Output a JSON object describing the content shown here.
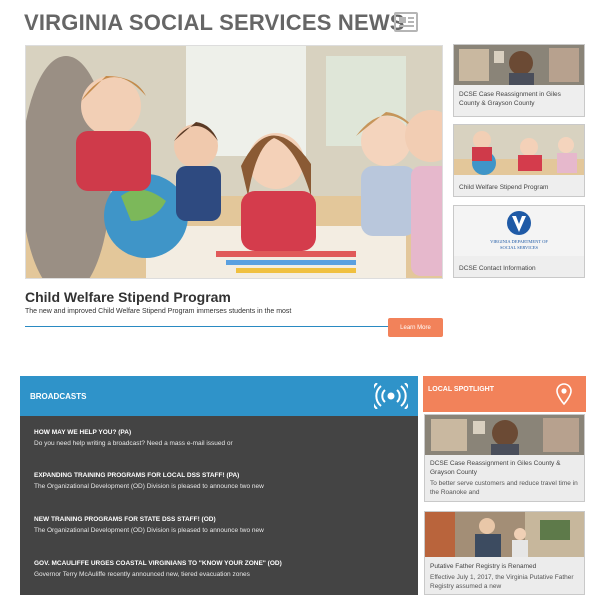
{
  "header": {
    "title": "VIRGINIA SOCIAL SERVICES NEWS",
    "icon": "newspaper-icon"
  },
  "featured": {
    "title": "Child Welfare Stipend Program",
    "description": "The new and improved Child Welfare Stipend Program immerses students in the most",
    "button_label": "Learn More"
  },
  "side_news": [
    {
      "label": "DCSE Case Reassignment in Giles County & Grayson County"
    },
    {
      "label": "Child Welfare Stipend Program"
    },
    {
      "label": "DCSE Contact Information",
      "logo_line1": "VIRGINIA DEPARTMENT OF",
      "logo_line2": "SOCIAL SERVICES"
    }
  ],
  "broadcasts": {
    "title": "BROADCASTS",
    "icon": "broadcast-icon",
    "items": [
      {
        "title": "HOW MAY WE HELP YOU? (PA)",
        "summary": "Do you need help writing a broadcast? Need a mass e-mail issued or"
      },
      {
        "title": "EXPANDING TRAINING PROGRAMS FOR LOCAL DSS STAFF! (PA)",
        "summary": "The Organizational Development (OD) Division is pleased to announce two new"
      },
      {
        "title": "NEW TRAINING PROGRAMS FOR STATE DSS STAFF! (OD)",
        "summary": "The Organizational Development (OD) Division is pleased to announce two new"
      },
      {
        "title": "GOV. MCAULIFFE URGES COASTAL VIRGINIANS TO \"KNOW YOUR ZONE\" (OD)",
        "summary": "Governor Terry McAuliffe recently announced new, tiered evacuation zones"
      }
    ]
  },
  "spotlight": {
    "title": "LOCAL SPOTLIGHT",
    "icon": "map-pin-icon",
    "items": [
      {
        "title": "DCSE Case Reassignment in Giles County & Grayson County",
        "summary": "To better serve customers and reduce travel time in the Roanoke and"
      },
      {
        "title": "Putative Father Registry is Renamed",
        "summary": "Effective July 1, 2017, the Virginia Putative Father Registry assumed a new"
      }
    ]
  },
  "colors": {
    "blue": "#2f93c9",
    "orange": "#f2825a",
    "dark": "#444444",
    "title_gray": "#666666"
  }
}
